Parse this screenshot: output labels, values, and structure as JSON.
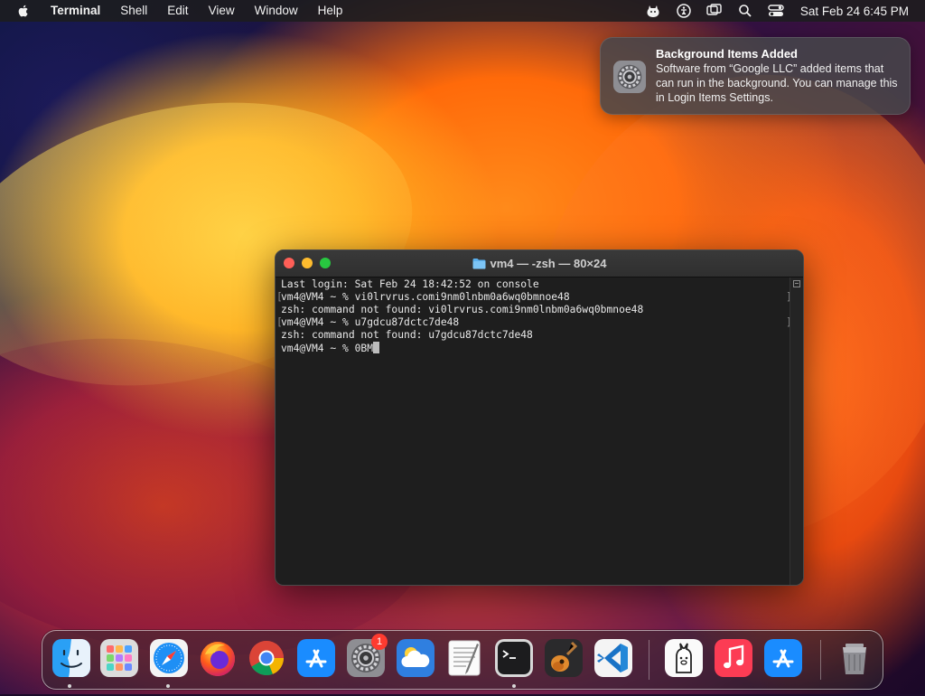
{
  "menubar": {
    "app_name": "Terminal",
    "items": [
      "Shell",
      "Edit",
      "View",
      "Window",
      "Help"
    ],
    "clock": "Sat Feb 24  6:45 PM"
  },
  "notification": {
    "title": "Background Items Added",
    "body": "Software from “Google LLC” added items that can run in the background. You can manage this in Login Items Settings.",
    "icon": "system-settings-icon"
  },
  "terminal": {
    "title": "vm4 — -zsh — 80×24",
    "lines": [
      "Last login: Sat Feb 24 18:42:52 on console",
      "vm4@VM4 ~ % vi0lrvrus.comi9nm0lnbm0a6wq0bmnoe48",
      "zsh: command not found: vi0lrvrus.comi9nm0lnbm0a6wq0bmnoe48",
      "vm4@VM4 ~ % u7gdcu87dctc7de48",
      "zsh: command not found: u7gdcu87dctc7de48",
      "vm4@VM4 ~ % 0BM"
    ]
  },
  "dock": {
    "apps": [
      {
        "name": "Finder",
        "running": true
      },
      {
        "name": "Launchpad",
        "running": false
      },
      {
        "name": "Safari",
        "running": true
      },
      {
        "name": "Firefox",
        "running": false
      },
      {
        "name": "Google Chrome",
        "running": false
      },
      {
        "name": "App Store",
        "running": false
      },
      {
        "name": "System Settings",
        "running": false,
        "badge": "1"
      },
      {
        "name": "Weather",
        "running": false
      },
      {
        "name": "TextEdit",
        "running": false
      },
      {
        "name": "Terminal",
        "running": true
      },
      {
        "name": "GarageBand",
        "running": false
      },
      {
        "name": "Visual Studio Code",
        "running": false
      },
      {
        "name": "Ollama",
        "running": false
      },
      {
        "name": "Music",
        "running": false
      },
      {
        "name": "App Store",
        "running": false
      },
      {
        "name": "Trash",
        "running": false
      }
    ]
  },
  "colors": {
    "accent_close": "#ff5f57",
    "accent_min": "#febc2e",
    "accent_max": "#28c840",
    "badge": "#ff3b30"
  }
}
